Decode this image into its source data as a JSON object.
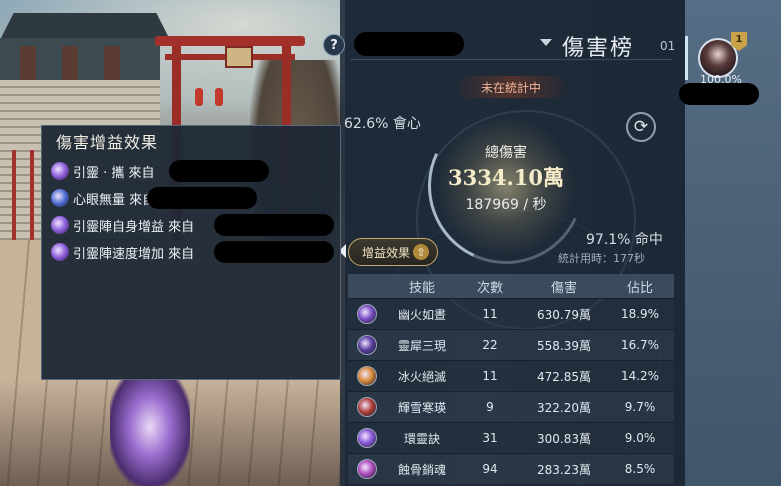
{
  "header": {
    "help_icon": "?",
    "board_title": "傷害榜",
    "board_number": "01"
  },
  "status": "未在統計中",
  "stats": {
    "crit": "62.6% 會心",
    "total_label": "總傷害",
    "total_value": "3334.10萬",
    "dps": "187969 / 秒",
    "hit": "97.1% 命中",
    "time": "統計用時：177秒"
  },
  "buff_button": {
    "label": "增益效果",
    "icon": "up-arrow-icon"
  },
  "avatar": {
    "rank": "1",
    "percent": "100.0%"
  },
  "table": {
    "headers": {
      "skill": "技能",
      "count": "次數",
      "damage": "傷害",
      "pct": "佔比"
    },
    "rows": [
      {
        "name": "幽火如晝",
        "count": "11",
        "damage": "630.79萬",
        "pct": "18.9%",
        "icon_color": "#7a4fc4"
      },
      {
        "name": "靈犀三現",
        "count": "22",
        "damage": "558.39萬",
        "pct": "16.7%",
        "icon_color": "#5a3fa0"
      },
      {
        "name": "冰火絕滅",
        "count": "11",
        "damage": "472.85萬",
        "pct": "14.2%",
        "icon_color": "#d98a3a"
      },
      {
        "name": "輝雪寒瑛",
        "count": "9",
        "damage": "322.20萬",
        "pct": "9.7%",
        "icon_color": "#b0423a"
      },
      {
        "name": "環靈訣",
        "count": "31",
        "damage": "300.83萬",
        "pct": "9.0%",
        "icon_color": "#8a5ad8"
      },
      {
        "name": "蝕骨銷魂",
        "count": "94",
        "damage": "283.23萬",
        "pct": "8.5%",
        "icon_color": "#b04fc0"
      }
    ]
  },
  "tooltip": {
    "title": "傷害增益效果",
    "items": [
      {
        "label": "引靈 · 攜 來自",
        "icon_color": "#8a5ad8"
      },
      {
        "label": "心眼無量 來自",
        "icon_color": "#4a6ad0"
      },
      {
        "label": "引靈陣自身增益 來自",
        "icon_color": "#8a5ad8"
      },
      {
        "label": "引靈陣速度增加 來自",
        "icon_color": "#8a5ad8"
      }
    ]
  }
}
